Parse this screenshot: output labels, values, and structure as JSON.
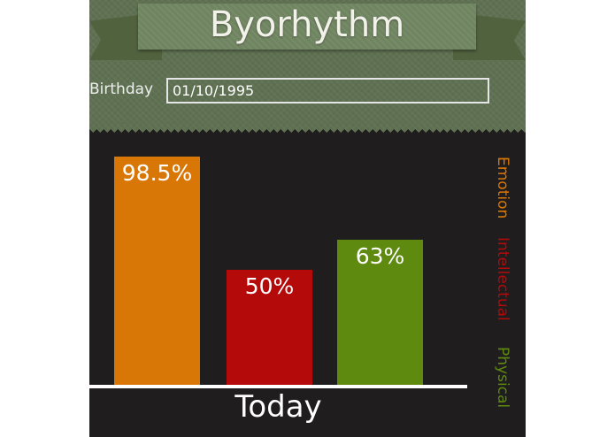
{
  "header": {
    "title": "Byorhythm",
    "birthday_label": "Birthday",
    "birthday_value": "01/10/1995"
  },
  "chart_data": {
    "type": "bar",
    "categories": [
      "Emotion",
      "Intellectual",
      "Physical"
    ],
    "values": [
      98.5,
      50,
      63
    ],
    "value_labels": [
      "98.5%",
      "50%",
      "63%"
    ],
    "colors": [
      "#d97706",
      "#b40a0a",
      "#5e8a10"
    ],
    "legend_colors": [
      "#d97706",
      "#b40a0a",
      "#5e8a10"
    ],
    "xlabel": "Today",
    "ylim": [
      0,
      100
    ],
    "legend": "right"
  }
}
